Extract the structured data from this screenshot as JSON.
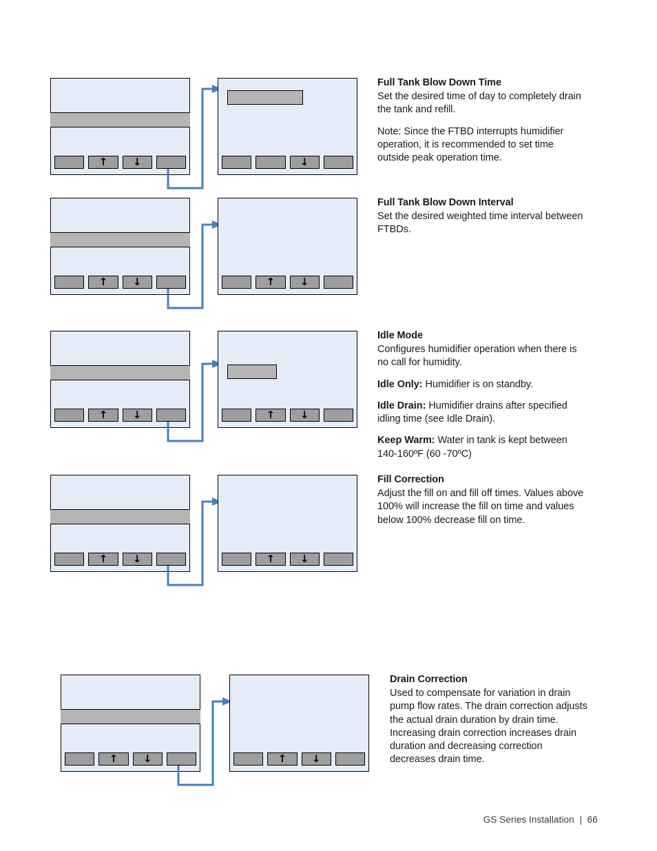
{
  "page": {
    "footer": "GS Series Installation  |  66"
  },
  "icons": {
    "up_arrow": "↑",
    "down_arrow": "↓"
  },
  "colors": {
    "lcd_background": "#e4ecf7",
    "lcd_border": "#000000",
    "highlight_grey": "#b5b5b5",
    "softkey_grey": "#9e9e9e",
    "connector_blue": "#4a7ebb",
    "page_background": "#ffffff",
    "body_text": "#1a1a1a"
  },
  "sections": [
    {
      "id": "full-tank-blow-down-time",
      "title": "Full Tank Blow Down Time",
      "paragraphs": [
        "Set the desired time of day to completely drain the tank and refill.",
        "Note:    Since the FTBD interrupts humidifier operation, it is recommended to set time outside peak operation time."
      ]
    },
    {
      "id": "full-tank-blow-down-interval",
      "title": "Full Tank Blow Down Interval",
      "paragraphs": [
        "Set the desired weighted time interval between FTBDs."
      ]
    },
    {
      "id": "idle-mode",
      "title": "Idle Mode",
      "paragraphs": [
        "Configures humidifier operation when there is no call for humidity."
      ],
      "definitions": [
        {
          "term": "Idle Only:",
          "text": " Humidifier is on standby."
        },
        {
          "term": "Idle Drain:",
          "text": " Humidifier drains after specified idling time (see Idle Drain)."
        },
        {
          "term": "Keep Warm:",
          "text": " Water in tank is kept between 140-160ºF (60 -70ºC)"
        }
      ]
    },
    {
      "id": "fill-correction",
      "title": "Fill Correction",
      "paragraphs": [
        "Adjust the fill on and fill off times. Values above 100% will increase the fill on time and values below 100% decrease fill on time."
      ]
    },
    {
      "id": "drain-correction",
      "title": "Drain Correction",
      "paragraphs": [
        "Used to compensate for variation in drain pump flow rates.  The drain correction adjusts the actual drain duration by drain time.  Increasing drain correction increases drain duration and decreasing correction decreases drain time."
      ]
    }
  ],
  "screens": {
    "menu_softkeys": [
      "",
      "up_arrow",
      "down_arrow",
      ""
    ],
    "detail_softkeys_down_only": [
      "",
      "",
      "down_arrow",
      ""
    ],
    "detail_softkeys_up_down": [
      "",
      "up_arrow",
      "down_arrow",
      ""
    ]
  }
}
